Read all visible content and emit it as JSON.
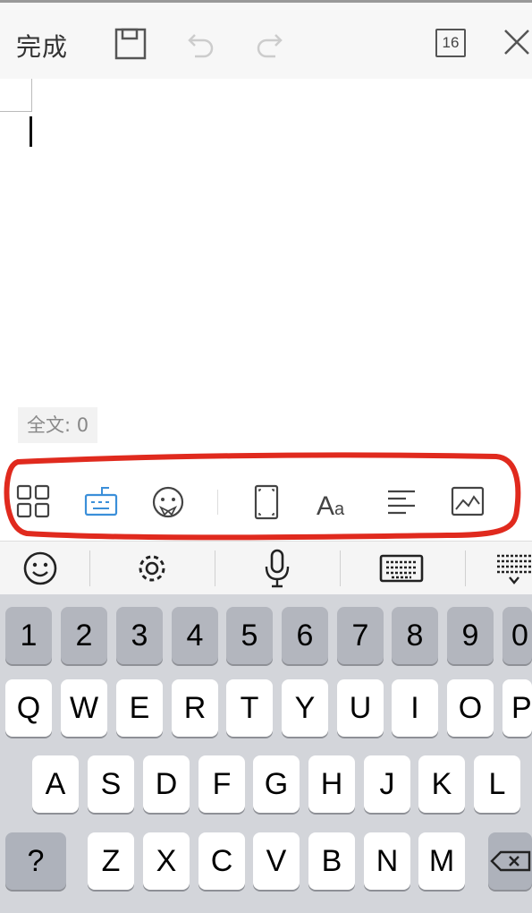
{
  "header": {
    "done_label": "完成",
    "page_count": "16"
  },
  "editor": {
    "word_count": "全文: 0"
  },
  "format_toolbar": {
    "items": [
      "grid-icon",
      "keyboard-icon",
      "emoji-icon",
      "fullscreen-icon",
      "font-icon",
      "align-left-icon",
      "image-icon"
    ],
    "accent": "#3b8fd9",
    "highlight_color": "#e02a1e"
  },
  "keyboard": {
    "top_bar": [
      "smiley-icon",
      "gear-icon",
      "microphone-icon",
      "keyboard-icon",
      "collapse-icon"
    ],
    "row_numbers": [
      "1",
      "2",
      "3",
      "4",
      "5",
      "6",
      "7",
      "8",
      "9",
      "0"
    ],
    "row1": [
      "Q",
      "W",
      "E",
      "R",
      "T",
      "Y",
      "U",
      "I",
      "O",
      "P"
    ],
    "row2": [
      "A",
      "S",
      "D",
      "F",
      "G",
      "H",
      "J",
      "K",
      "L"
    ],
    "row3": [
      "Z",
      "X",
      "C",
      "V",
      "B",
      "N",
      "M"
    ],
    "symbol_key": "?"
  }
}
